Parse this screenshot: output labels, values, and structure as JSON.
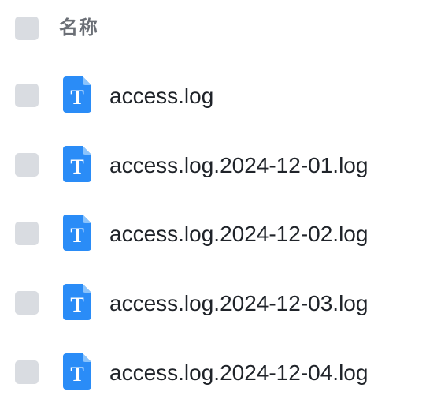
{
  "header": {
    "name_label": "名称"
  },
  "file_icon": {
    "name": "text-file-icon",
    "glyph": "T",
    "color": "#2a8cf7"
  },
  "files": [
    {
      "name": "access.log"
    },
    {
      "name": "access.log.2024-12-01.log"
    },
    {
      "name": "access.log.2024-12-02.log"
    },
    {
      "name": "access.log.2024-12-03.log"
    },
    {
      "name": "access.log.2024-12-04.log"
    }
  ]
}
